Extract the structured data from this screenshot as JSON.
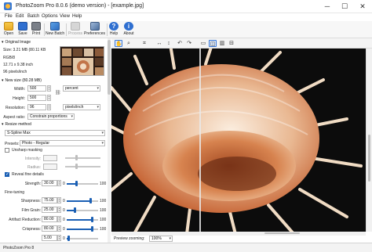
{
  "window": {
    "title": "PhotoZoom Pro 8.0.6 (demo version) - [example.jpg]",
    "minimize_glyph": "─",
    "maximize_glyph": "☐",
    "close_glyph": "✕"
  },
  "menu": [
    "File",
    "Edit",
    "Batch",
    "Options",
    "View",
    "Help"
  ],
  "toolbar": {
    "open": "Open",
    "save": "Save",
    "print": "Print",
    "new_batch": "New Batch",
    "process": "Process",
    "preferences": "Preferences",
    "help": "Help",
    "about": "About"
  },
  "original_image": {
    "heading": "Original Image",
    "size": "Size: 3.21 MB (80.11 KB",
    "mode": "RGB/8",
    "dimensions": "12.71 x 9.38 inch",
    "resolution": "96 pixels/inch"
  },
  "new_size": {
    "heading": "New size (80.28 MB)",
    "width_label": "Width:",
    "width_value": "500",
    "width_unit": "percent",
    "height_label": "Height:",
    "height_value": "500",
    "resolution_label": "Resolution:",
    "resolution_value": "96",
    "resolution_unit": "pixels/inch",
    "aspect_label": "Aspect ratio:",
    "aspect_value": "Constrain proportions"
  },
  "resize_method": {
    "heading": "Resize method",
    "method": "S-Spline Max",
    "presets_label": "Presets:",
    "preset": "Photo - Regular",
    "unsharp_label": "Unsharp masking",
    "unsharp_checked": false,
    "intensity_label": "Intensity:",
    "radius_label": "Radius:",
    "reveal_label": "Reveal fine details",
    "reveal_checked": true,
    "strength_label": "Strength:",
    "strength_value": "30.00",
    "strength_min": "0",
    "strength_max": "100",
    "strength_level": 0.3
  },
  "fine_tuning": {
    "heading": "Fine-tuning",
    "rows": [
      {
        "label": "Sharpness:",
        "value": "75.00",
        "min": "0",
        "max": "100",
        "level": 0.75
      },
      {
        "label": "Film Grain:",
        "value": "25.00",
        "min": "0",
        "max": "100",
        "level": 0.25
      },
      {
        "label": "Artifact Reduction:",
        "value": "80.00",
        "min": "0",
        "max": "100",
        "level": 0.8
      },
      {
        "label": "Crispness:",
        "value": "80.00",
        "min": "0",
        "max": "100",
        "level": 0.8
      },
      {
        "label": "",
        "value": "5.00",
        "min": "0",
        "max": "",
        "level": 0.05
      }
    ]
  },
  "preview": {
    "zoom_label": "Preview zooming:",
    "zoom_value": "100%"
  },
  "status": {
    "app": "PhotoZoom Pro 8"
  },
  "colors": {
    "accent": "#1a5fb4",
    "shell_orange": "#d9784a",
    "shell_cream": "#f3e4d4"
  }
}
